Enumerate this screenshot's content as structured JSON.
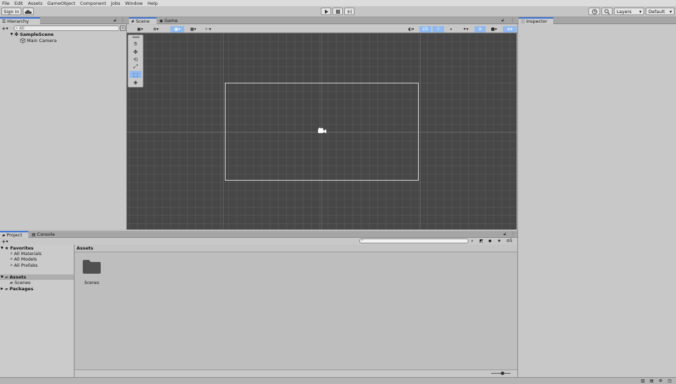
{
  "menu": [
    "File",
    "Edit",
    "Assets",
    "GameObject",
    "Component",
    "Jobs",
    "Window",
    "Help"
  ],
  "toolbar": {
    "sign_in": "Sign in",
    "cloud_icon": "cloud-icon",
    "play_icon": "play-icon",
    "pause_icon": "pause-icon",
    "step_icon": "step-icon",
    "history_icon": "history-icon",
    "search_icon": "search-icon",
    "layers": "Layers",
    "layout": "Default"
  },
  "hierarchy": {
    "tab": "Hierarchy",
    "search_placeholder": "All",
    "scene": "SampleScene",
    "items": [
      "Main Camera"
    ]
  },
  "scene_tabs": {
    "scene": "Scene",
    "game": "Game",
    "mode_2d": "2D"
  },
  "inspector": {
    "tab": "Inspector"
  },
  "project": {
    "tab_project": "Project",
    "tab_console": "Console",
    "favorites": "Favorites",
    "favorite_items": [
      "All Materials",
      "All Models",
      "All Prefabs"
    ],
    "assets": "Assets",
    "asset_children": [
      "Scenes"
    ],
    "packages": "Packages",
    "breadcrumb": "Assets",
    "hidden_count": "5",
    "folders": [
      {
        "name": "Scenes"
      }
    ]
  },
  "colors": {
    "accent": "#3a72d8",
    "scene_bg": "#474747",
    "toggle_on": "#8fb9ef",
    "folder": "#505050"
  }
}
